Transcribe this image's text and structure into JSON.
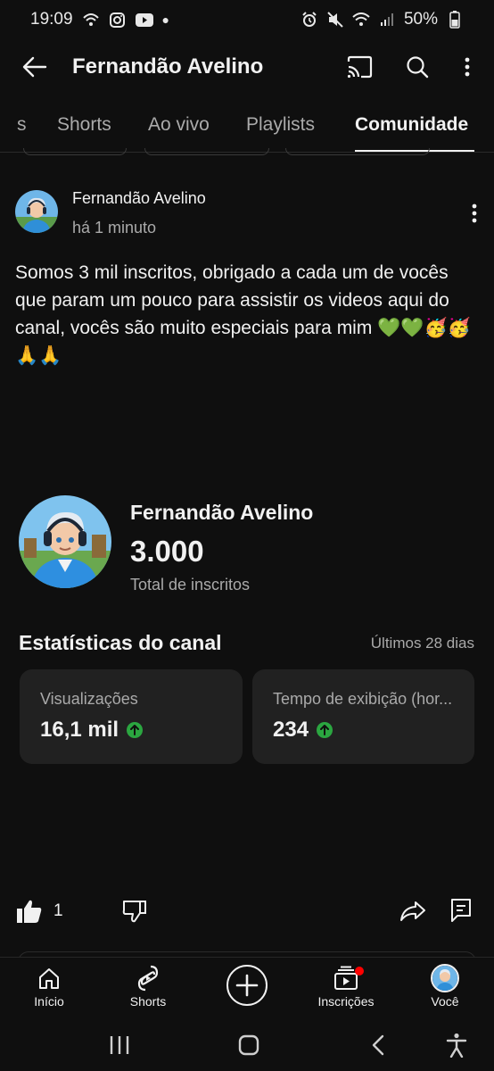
{
  "status_bar": {
    "time": "19:09",
    "battery": "50%",
    "left_icons": [
      "wifi-calling-icon",
      "instagram-icon",
      "youtube-icon",
      "dot-icon"
    ],
    "right_icons": [
      "alarm-icon",
      "mute-icon",
      "wifi-icon",
      "signal-icon",
      "battery-icon"
    ]
  },
  "appbar": {
    "title": "Fernandão Avelino",
    "icons": [
      "back-arrow-icon",
      "cast-icon",
      "search-icon",
      "more-vert-icon"
    ]
  },
  "tabs": [
    {
      "label": "s",
      "active": false
    },
    {
      "label": "Shorts",
      "active": false
    },
    {
      "label": "Ao vivo",
      "active": false
    },
    {
      "label": "Playlists",
      "active": false
    },
    {
      "label": "Comunidade",
      "active": true
    }
  ],
  "post": {
    "author": "Fernandão Avelino",
    "time": "há 1 minuto",
    "text": "Somos 3 mil inscritos, obrigado a cada um de vocês que param um pouco para assistir os videos aqui do canal, vocês são muito especiais para mim 💚💚🥳🥳🙏🙏",
    "likes": "1"
  },
  "channel_card": {
    "name": "Fernandão Avelino",
    "subscribers": "3.000",
    "subscribers_label": "Total de inscritos"
  },
  "stats": {
    "title": "Estatísticas do canal",
    "range": "Últimos 28 dias",
    "cards": [
      {
        "label": "Visualizações",
        "value": "16,1 mil",
        "trend": "up"
      },
      {
        "label": "Tempo de exibição (hor...",
        "value": "234",
        "trend": "up"
      }
    ]
  },
  "bottom_nav": [
    {
      "label": "Início",
      "icon": "home-icon"
    },
    {
      "label": "Shorts",
      "icon": "shorts-icon"
    },
    {
      "label": "",
      "icon": "create-plus-icon"
    },
    {
      "label": "Inscrições",
      "icon": "subscriptions-icon"
    },
    {
      "label": "Você",
      "icon": "avatar"
    }
  ],
  "colors": {
    "background": "#0f0f0f",
    "card": "#212121",
    "text_primary": "#f1f1f1",
    "text_secondary": "#aaaaaa",
    "trend_up": "#2ba640",
    "notification": "#ff0000"
  }
}
